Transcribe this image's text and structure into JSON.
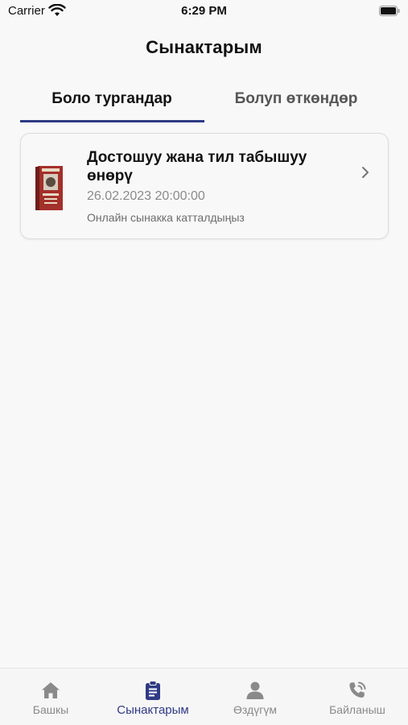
{
  "status_bar": {
    "carrier": "Carrier",
    "time": "6:29 PM"
  },
  "page": {
    "title": "Сынактарым"
  },
  "tabs": [
    {
      "label": "Боло тургандар",
      "active": true
    },
    {
      "label": "Болуп өткөндөр",
      "active": false
    }
  ],
  "exams": [
    {
      "title": "Достошуу жана тил табышуу өнөрү",
      "date": "26.02.2023 20:00:00",
      "status": "Онлайн сынакка катталдыңыз"
    }
  ],
  "bottom_nav": [
    {
      "label": "Башкы",
      "icon": "home-icon",
      "active": false
    },
    {
      "label": "Сынактарым",
      "icon": "clipboard-icon",
      "active": true
    },
    {
      "label": "Өздүгүм",
      "icon": "person-icon",
      "active": false
    },
    {
      "label": "Байланыш",
      "icon": "phone-call-icon",
      "active": false
    }
  ],
  "colors": {
    "accent": "#2f3a84",
    "inactive": "#8a8a8a",
    "background": "#f8f8f8"
  }
}
